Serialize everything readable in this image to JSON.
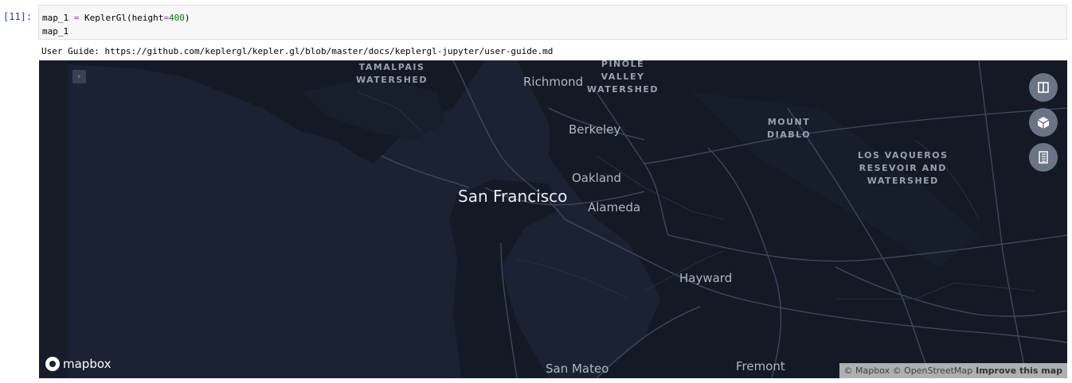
{
  "cell": {
    "prompt": "[11]:",
    "code_line1": {
      "var": "map_1 ",
      "op": "=",
      "call": " KeplerGl(height",
      "eq": "=",
      "num": "400",
      "close": ")"
    },
    "code_line2": "map_1"
  },
  "output": {
    "user_guide": "User Guide: https://github.com/keplergl/kepler.gl/blob/master/docs/keplergl-jupyter/user-guide.md"
  },
  "map": {
    "side_toggle": "›",
    "controls": [
      {
        "name": "split-map-icon"
      },
      {
        "name": "3d-map-icon"
      },
      {
        "name": "legend-icon"
      }
    ],
    "labels": {
      "tamalpais": [
        "TAMALPAIS",
        "WATERSHED"
      ],
      "pinole": [
        "PINOLE",
        "VALLEY",
        "WATERSHED"
      ],
      "mount_diablo": [
        "MOUNT",
        "DIABLO"
      ],
      "los_vaqueros": [
        "LOS VAQUEROS",
        "RESEVOIR AND",
        "WATERSHED"
      ],
      "richmond": "Richmond",
      "berkeley": "Berkeley",
      "oakland": "Oakland",
      "san_francisco": "San Francisco",
      "alameda": "Alameda",
      "hayward": "Hayward",
      "san_mateo": "San Mateo",
      "fremont": "Fremont"
    },
    "mapbox_logo": "mapbox",
    "attribution": {
      "text": "© Mapbox © OpenStreetMap",
      "improve": "Improve this map"
    },
    "colors": {
      "water": "#1b2231",
      "land": "#131a26",
      "roads": "#3f4b5e"
    }
  }
}
